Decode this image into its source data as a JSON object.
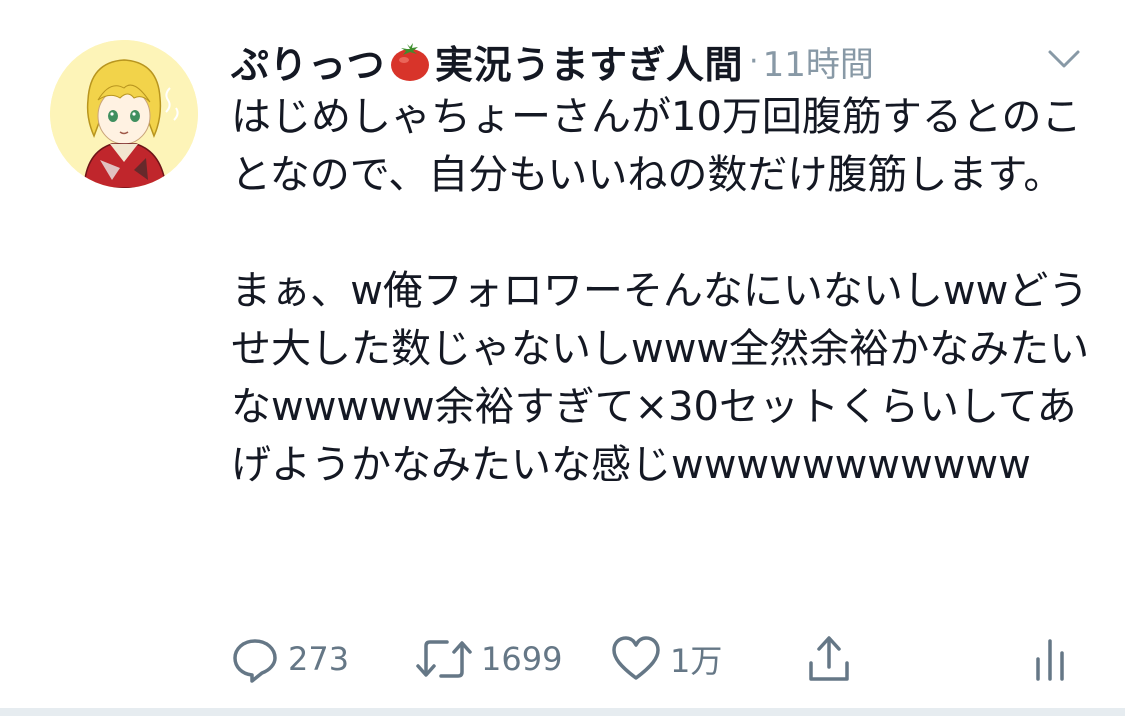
{
  "tweet": {
    "author_name_part1": "ぷりっつ",
    "author_name_part2": "実況うますぎ人間",
    "separator": "·",
    "time": "11時間",
    "body": "はじめしゃちょーさんが10万回腹筋するとのことなので、自分もいいねの数だけ腹筋します。\n\nまぁ、w俺フォロワーそんなにいないしwwどうせ大した数じゃないしwww全然余裕かなみたいなwwwww余裕すぎて×30セットくらいしてあげようかなみたいな感じwwwwwwwwwww",
    "actions": {
      "reply_count": "273",
      "retweet_count": "1699",
      "like_count": "1万"
    }
  },
  "icons": {
    "avatar": "avatar-anime-character",
    "tomato": "tomato-emoji",
    "caret": "chevron-down-icon",
    "reply": "reply-icon",
    "retweet": "retweet-icon",
    "like": "heart-icon",
    "share": "share-icon",
    "analytics": "analytics-icon"
  },
  "colors": {
    "text": "#141823",
    "secondary": "#8899a6",
    "action": "#657786",
    "avatar_bg": "#fdf4b8"
  }
}
